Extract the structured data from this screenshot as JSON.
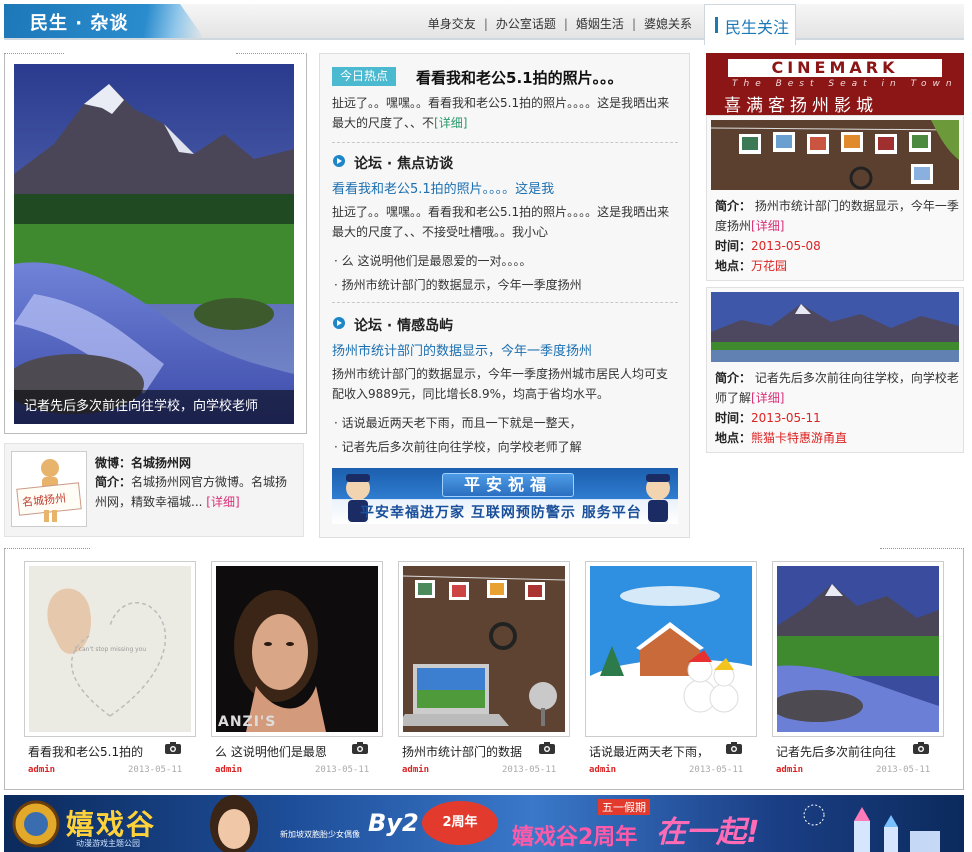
{
  "header": {
    "brand": "民生 · 杂谈",
    "nav": [
      "单身交友",
      "办公室话题",
      "婚姻生活",
      "婆媳关系"
    ],
    "separator": "|",
    "active_tab": "民生关注"
  },
  "feature": {
    "caption": "记者先后多次前往向往学校，向学校老师"
  },
  "weibo": {
    "label_weibo": "微博：",
    "name": "名城扬州网",
    "label_intro": "简介：",
    "intro": "名城扬州网官方微博。名城扬州网，精致幸福城...",
    "more": "[详细]",
    "logo_text": "名城扬州"
  },
  "hot": {
    "badge": "今日热点",
    "title": "看看我和老公5.1拍的照片。。。",
    "text": "扯远了。。嘿嘿。。看看我和老公5.1拍的照片。。。。这是我晒出来最大的尺度了、、不",
    "more": "[详细]"
  },
  "forum1": {
    "heading": "论坛 · 焦点访谈",
    "link": "看看我和老公5.1拍的照片。。。。这是我",
    "text": "扯远了。。嘿嘿。。看看我和老公5.1拍的照片。。。。这是我晒出来最大的尺度了、、不接受吐槽哦。。我小心",
    "bullets": [
      "· 么 这说明他们是最恩爱的一对。。。。",
      "· 扬州市统计部门的数据显示，今年一季度扬州"
    ]
  },
  "forum2": {
    "heading": "论坛 · 情感岛屿",
    "link": "扬州市统计部门的数据显示，今年一季度扬州",
    "text": "扬州市统计部门的数据显示，今年一季度扬州城市居民人均可支配收入9889元，同比增长8.9%，均高于省均水平。",
    "bullets": [
      "· 话说最近两天老下雨，而且一下就是一整天，",
      "· 记者先后多次前往向往学校，向学校老师了解"
    ]
  },
  "ad_mid": {
    "title": "平安祝福",
    "slogan": "平安幸福进万家  互联网预防警示  服务平台"
  },
  "cinema": {
    "brand": "CINEMARK",
    "tagline": "The Best Seat in Town",
    "name_cn": "喜满客扬州影城"
  },
  "events": [
    {
      "label_intro": "简介：",
      "intro": "扬州市统计部门的数据显示，今年一季度扬州",
      "more": "[详细]",
      "label_time": "时间：",
      "time": "2013-05-08",
      "label_place": "地点：",
      "place": "万花园"
    },
    {
      "label_intro": "简介：",
      "intro": "记者先后多次前往向往学校，向学校老师了解",
      "more": "[详细]",
      "label_time": "时间：",
      "time": "2013-05-11",
      "label_place": "地点：",
      "place": "熊猫卡特惠游甬直"
    }
  ],
  "thumbs": [
    {
      "title": "看看我和老公5.1拍的",
      "author": "admin",
      "date": "2013-05-11",
      "img_text": "I can't stop missing you"
    },
    {
      "title": "么 这说明他们是最恩",
      "author": "admin",
      "date": "2013-05-11",
      "img_text": "ANZI'S"
    },
    {
      "title": "扬州市统计部门的数据",
      "author": "admin",
      "date": "2013-05-11"
    },
    {
      "title": "话说最近两天老下雨，",
      "author": "admin",
      "date": "2013-05-11"
    },
    {
      "title": "记者先后多次前往向往",
      "author": "admin",
      "date": "2013-05-11"
    }
  ],
  "ad_bottom": {
    "brand": "嬉戏谷",
    "sub": "动漫游戏主题公园",
    "by2": "By2",
    "promo": "嬉戏谷2周年",
    "holiday": "五一假期",
    "slogan": "在一起!",
    "small": "新加坡双胞胎少女偶像",
    "badge": "2周年"
  },
  "colors": {
    "brand_blue": "#1d78b8",
    "accent_pink": "#d93078",
    "date_red": "#d22222",
    "badge_teal": "#4bb9cf"
  }
}
